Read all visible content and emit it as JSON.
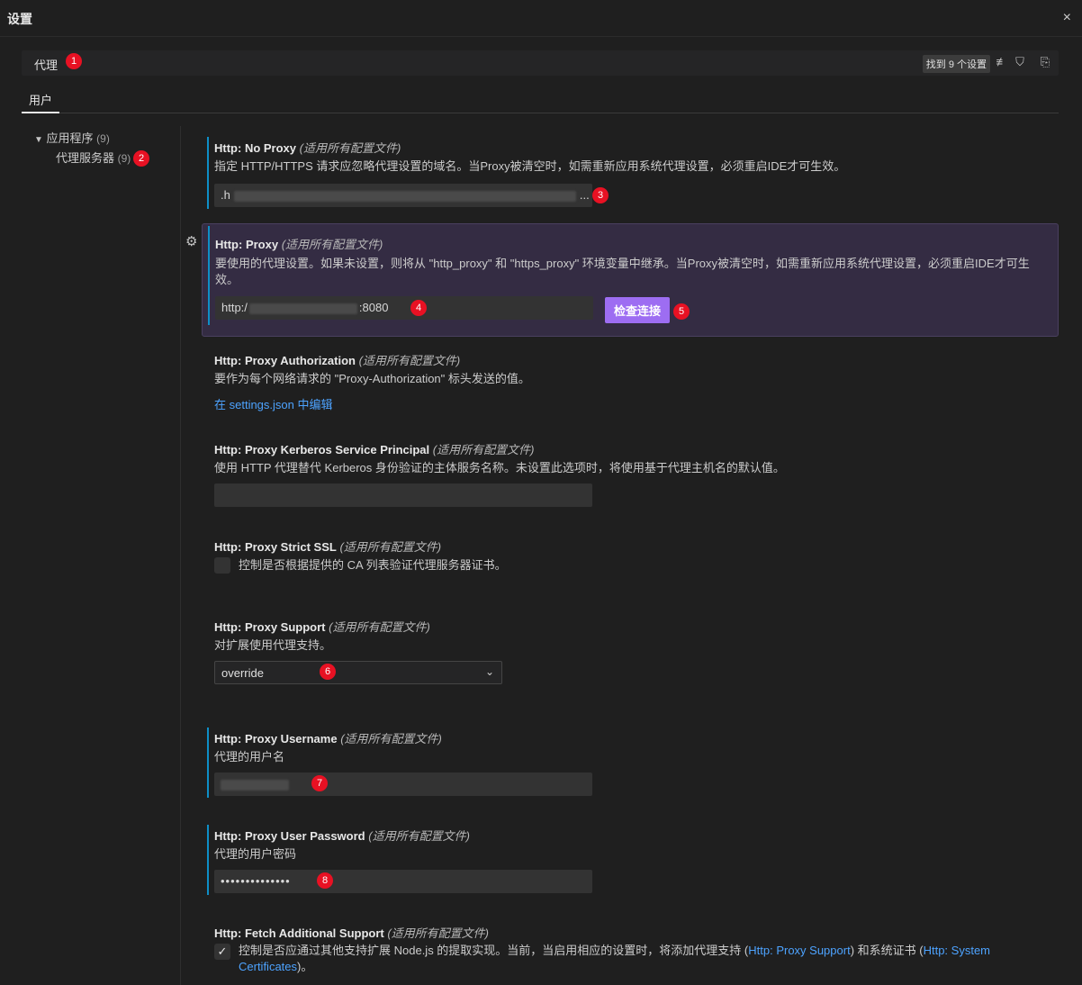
{
  "window": {
    "title": "设置",
    "close": "×"
  },
  "search": {
    "query": "代理",
    "result_count": "找到 9 个设置"
  },
  "tabs": [
    {
      "label": "用户"
    }
  ],
  "tree": {
    "group": {
      "label": "应用程序",
      "count": "(9)"
    },
    "child": {
      "label": "代理服务器",
      "count": "(9)"
    }
  },
  "scope_text": "(适用所有配置文件)",
  "settings": {
    "no_proxy": {
      "prefix": "Http: ",
      "name": "No Proxy",
      "desc": "指定 HTTP/HTTPS 请求应忽略代理设置的域名。当Proxy被清空时，如需重新应用系统代理设置，必须重启IDE才可生效。",
      "value_start": ".h",
      "value_end": "..."
    },
    "proxy": {
      "prefix": "Http: ",
      "name": "Proxy",
      "desc": "要使用的代理设置。如果未设置，则将从 \"http_proxy\" 和 \"https_proxy\" 环境变量中继承。当Proxy被清空时，如需重新应用系统代理设置，必须重启IDE才可生效。",
      "value_start": "http:/",
      "value_end": ":8080",
      "button": "检查连接"
    },
    "proxy_authorization": {
      "prefix": "Http: ",
      "name": "Proxy Authorization",
      "desc": "要作为每个网络请求的 \"Proxy-Authorization\" 标头发送的值。",
      "link": "在 settings.json 中编辑"
    },
    "kerberos": {
      "prefix": "Http: ",
      "name": "Proxy Kerberos Service Principal",
      "desc": "使用 HTTP 代理替代 Kerberos 身份验证的主体服务名称。未设置此选项时，将使用基于代理主机名的默认值。",
      "value": ""
    },
    "strict_ssl": {
      "prefix": "Http: ",
      "name": "Proxy Strict SSL",
      "checkbox_label": "控制是否根据提供的 CA 列表验证代理服务器证书。",
      "checked": false
    },
    "proxy_support": {
      "prefix": "Http: ",
      "name": "Proxy Support",
      "desc": "对扩展使用代理支持。",
      "selected": "override"
    },
    "username": {
      "prefix": "Http: ",
      "name": "Proxy Username",
      "desc": "代理的用户名"
    },
    "password": {
      "prefix": "Http: ",
      "name": "Proxy User Password",
      "desc": "代理的用户密码",
      "value": "••••••••••••••"
    },
    "fetch_support": {
      "prefix": "Http: ",
      "name": "Fetch Additional Support",
      "checkbox_part1": "控制是否应通过其他支持扩展 Node.js 的提取实现。当前，当启用相应的设置时，将添加代理支持 (",
      "link1": "Http: Proxy Support",
      "checkbox_part2": ") 和系统证书 (",
      "link2": "Http: System Certificates",
      "checkbox_part3": ")。",
      "checked": true
    }
  },
  "markers": [
    "1",
    "2",
    "3",
    "4",
    "5",
    "6",
    "7",
    "8"
  ],
  "colors": {
    "accent_button": "#9d6df2",
    "modified_bar": "#0e8fc7",
    "link": "#4da3ff",
    "marker": "#e81123"
  }
}
